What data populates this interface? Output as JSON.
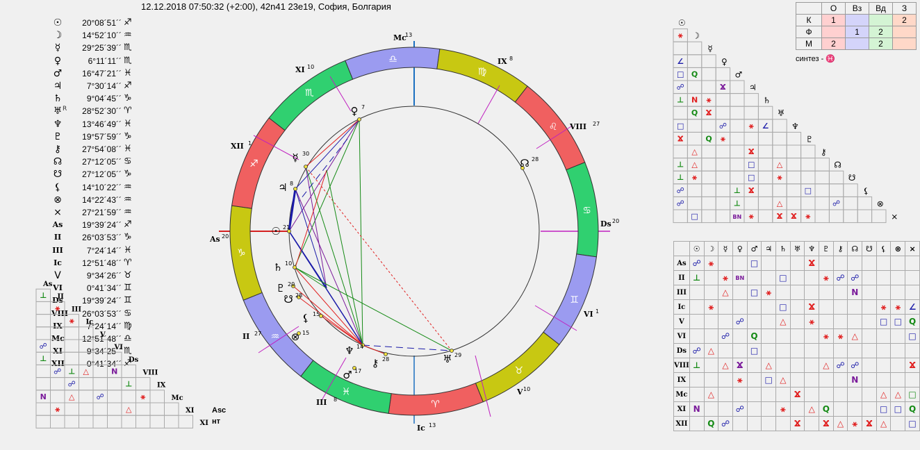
{
  "header": {
    "title": "12.12.2018 07:50:32 (+2:00), 42n41 23e19, София, Болгария"
  },
  "planets": [
    {
      "glyph": "☉",
      "pos": "20°08´51´´",
      "sign": "♐",
      "retro": ""
    },
    {
      "glyph": "☽",
      "pos": "14°52´10´´",
      "sign": "♒",
      "retro": ""
    },
    {
      "glyph": "☿",
      "pos": "29°25´39´´",
      "sign": "♏",
      "retro": ""
    },
    {
      "glyph": "♀",
      "pos": "6°11´11´´",
      "sign": "♏",
      "retro": ""
    },
    {
      "glyph": "♂",
      "pos": "16°47´21´´",
      "sign": "♓",
      "retro": ""
    },
    {
      "glyph": "♃",
      "pos": "7°30´14´´",
      "sign": "♐",
      "retro": ""
    },
    {
      "glyph": "♄",
      "pos": "9°04´45´´",
      "sign": "♑",
      "retro": ""
    },
    {
      "glyph": "♅",
      "pos": "28°52´30´´",
      "sign": "♈",
      "retro": "R"
    },
    {
      "glyph": "♆",
      "pos": "13°46´49´´",
      "sign": "♓",
      "retro": ""
    },
    {
      "glyph": "♇",
      "pos": "19°57´59´´",
      "sign": "♑",
      "retro": ""
    },
    {
      "glyph": "⚷",
      "pos": "27°54´08´´",
      "sign": "♓",
      "retro": ""
    },
    {
      "glyph": "☊",
      "pos": "27°12´05´´",
      "sign": "♋",
      "retro": ""
    },
    {
      "glyph": "☋",
      "pos": "27°12´05´´",
      "sign": "♑",
      "retro": ""
    },
    {
      "glyph": "⚸",
      "pos": "14°10´22´´",
      "sign": "♒",
      "retro": ""
    },
    {
      "glyph": "⊗",
      "pos": "14°22´43´´",
      "sign": "♒",
      "retro": ""
    },
    {
      "glyph": "⨯",
      "pos": "27°21´59´´",
      "sign": "♒",
      "retro": ""
    },
    {
      "glyph": "As",
      "pos": "19°39´24´´",
      "sign": "♐",
      "retro": ""
    },
    {
      "glyph": "II",
      "pos": "26°03´53´´",
      "sign": "♑",
      "retro": ""
    },
    {
      "glyph": "III",
      "pos": "7°24´14´´",
      "sign": "♓",
      "retro": ""
    },
    {
      "glyph": "Ic",
      "pos": "12°51´48´´",
      "sign": "♈",
      "retro": ""
    },
    {
      "glyph": "V",
      "pos": "9°34´26´´",
      "sign": "♉",
      "retro": ""
    },
    {
      "glyph": "VI",
      "pos": "0°41´34´´",
      "sign": "♊",
      "retro": ""
    },
    {
      "glyph": "Ds",
      "pos": "19°39´24´´",
      "sign": "♊",
      "retro": ""
    },
    {
      "glyph": "VIII",
      "pos": "26°03´53´´",
      "sign": "♋",
      "retro": ""
    },
    {
      "glyph": "IX",
      "pos": "7°24´14´´",
      "sign": "♍",
      "retro": ""
    },
    {
      "glyph": "Mc",
      "pos": "12°51´48´´",
      "sign": "♎",
      "retro": ""
    },
    {
      "glyph": "XI",
      "pos": "9°34´25´´",
      "sign": "♏",
      "retro": ""
    },
    {
      "glyph": "XII",
      "pos": "0°41´34´´",
      "sign": "♐",
      "retro": ""
    }
  ],
  "asc_nt": {
    "line1": "Asc",
    "line2": "нт"
  },
  "elements_table": {
    "columns": [
      "О",
      "Вз",
      "Вд",
      "З"
    ],
    "rows": [
      {
        "label": "К",
        "cells": [
          "1",
          "",
          "",
          "2"
        ]
      },
      {
        "label": "Ф",
        "cells": [
          "",
          "1",
          "2",
          ""
        ]
      },
      {
        "label": "М",
        "cells": [
          "2",
          "",
          "2",
          ""
        ]
      }
    ],
    "column_colors": [
      "#ffd0d0",
      "#d4d4fa",
      "#d4f4d4",
      "#ffd8c8"
    ]
  },
  "synthesis": "синтез - ♓",
  "aspect_symbols": {
    "conj": "☌",
    "opp": "☍",
    "tri": "△",
    "sq": "□",
    "sext": "⚹",
    "semisq": "∠",
    "sesq": "⚼",
    "quinc": "⚻",
    "semisext": "⊥",
    "novile": "N",
    "quint": "Q",
    "biquint": "BN"
  },
  "aspect_colors": {
    "red": "#e02020",
    "blue": "#1a1aa8",
    "green": "#158a15",
    "purple": "#7a1a9a"
  },
  "triangle_grid": {
    "headers": [
      "☉",
      "☽",
      "☿",
      "♀",
      "♂",
      "♃",
      "♄",
      "♅",
      "♆",
      "♇",
      "⚷",
      "☊",
      "☋",
      "⚸",
      "⊗",
      "⨯"
    ],
    "cells": [
      [],
      [
        "⚹r"
      ],
      [
        "",
        ""
      ],
      [
        "∠b",
        "",
        "",
        ""
      ],
      [
        "□b",
        "Qg",
        "",
        "",
        ""
      ],
      [
        "☍b",
        "",
        "",
        "Ϫp",
        "",
        ""
      ],
      [
        "⊥g",
        "Nr",
        "⚹r",
        "",
        "",
        "",
        ""
      ],
      [
        "",
        "Qg",
        "Ϫr",
        "",
        "",
        "",
        "",
        ""
      ],
      [
        "□b",
        "",
        "",
        "☍b",
        "",
        "⚹r",
        "∠b",
        ""
      ],
      [
        "Ϫr",
        "",
        "Qg",
        "⚹r",
        "",
        "",
        "",
        "",
        ""
      ],
      [
        "",
        "△r",
        "",
        "",
        "",
        "Ϫr",
        "",
        "",
        "",
        ""
      ],
      [
        "⊥g",
        "△r",
        "",
        "",
        "",
        "□b",
        "",
        "△r",
        "",
        "",
        ""
      ],
      [
        "⊥g",
        "⚹r",
        "",
        "",
        "",
        "□b",
        "",
        "⚹r",
        "",
        "",
        "",
        ""
      ],
      [
        "☍b",
        "",
        "",
        "",
        "⊥g",
        "Ϫr",
        "",
        "",
        "",
        "□b",
        "",
        "",
        ""
      ],
      [
        "☍b",
        "",
        "",
        "",
        "⊥g",
        "",
        "",
        "△r",
        "",
        "",
        "",
        "☍b",
        "",
        ""
      ],
      [
        "",
        "□b",
        "",
        "",
        "BNp",
        "⚹r",
        "",
        "Ϫr",
        "Ϫr",
        "⚹r",
        "",
        "",
        "",
        "",
        ""
      ]
    ]
  },
  "main_grid": {
    "col_headers": [
      "☉",
      "☽",
      "☿",
      "♀",
      "♂",
      "♃",
      "♄",
      "♅",
      "♆",
      "♇",
      "⚷",
      "☊",
      "☋",
      "⚸",
      "⊗",
      "⨯"
    ],
    "rows": [
      {
        "label": "As",
        "cells": [
          "☍b",
          "⚹r",
          "",
          "",
          "□b",
          "",
          "",
          "",
          "Ϫr",
          "",
          "",
          "",
          "",
          "",
          "",
          ""
        ]
      },
      {
        "label": "II",
        "cells": [
          "⊥g",
          "",
          "⚹r",
          "BNp",
          "",
          "",
          "□b",
          "",
          "",
          "⚹r",
          "☍b",
          "☍b",
          "",
          "",
          "",
          ""
        ]
      },
      {
        "label": "III",
        "cells": [
          "",
          "",
          "△r",
          "",
          "□b",
          "⚹r",
          "",
          "",
          "",
          "",
          "",
          "Np",
          "",
          "",
          "",
          ""
        ]
      },
      {
        "label": "Ic",
        "cells": [
          "",
          "⚹r",
          "",
          "",
          "",
          "",
          "□b",
          "",
          "Ϫr",
          "",
          "",
          "",
          "",
          "⚹r",
          "⚹r",
          "∠b"
        ]
      },
      {
        "label": "V",
        "cells": [
          "",
          "",
          "",
          "☍b",
          "",
          "",
          "△r",
          "",
          "⚹r",
          "",
          "",
          "",
          "",
          "□b",
          "□b",
          "Qg"
        ]
      },
      {
        "label": "VI",
        "cells": [
          "",
          "",
          "☍b",
          "",
          "Qg",
          "",
          "",
          "",
          "",
          "⚹r",
          "⚹r",
          "△r",
          "",
          "",
          "",
          "□b"
        ]
      },
      {
        "label": "Ds",
        "cells": [
          "☍b",
          "△r",
          "",
          "",
          "□b",
          "",
          "",
          "",
          "",
          "",
          "",
          "",
          "",
          "",
          "",
          ""
        ]
      },
      {
        "label": "VIII",
        "cells": [
          "⊥g",
          "",
          "△r",
          "Ϫp",
          "",
          "△r",
          "",
          "",
          "",
          "△r",
          "☍b",
          "☍b",
          "",
          "",
          "",
          "Ϫr"
        ]
      },
      {
        "label": "IX",
        "cells": [
          "",
          "",
          "",
          "⚹r",
          "",
          "□b",
          "△r",
          "",
          "",
          "",
          "",
          "Np",
          "",
          "",
          "",
          ""
        ]
      },
      {
        "label": "Mc",
        "cells": [
          "",
          "△r",
          "",
          "",
          "",
          "",
          "",
          "Ϫr",
          "",
          "",
          "",
          "",
          "",
          "△r",
          "△r",
          "□g"
        ]
      },
      {
        "label": "XI",
        "cells": [
          "Np",
          "",
          "",
          "☍b",
          "",
          "",
          "⚹r",
          "",
          "△r",
          "Qg",
          "",
          "",
          "",
          "□b",
          "□b",
          "Qg"
        ]
      },
      {
        "label": "XII",
        "cells": [
          "",
          "Qg",
          "☍b",
          "",
          "",
          "",
          "",
          "Ϫr",
          "",
          "Ϫr",
          "△r",
          "⚹r",
          "Ϫr",
          "△r",
          "",
          "□b"
        ]
      }
    ]
  },
  "small_grid": {
    "labels": [
      "As",
      "II",
      "III",
      "Ic",
      "V",
      "VI",
      "Ds",
      "VIII",
      "IX",
      "Mc",
      "XI",
      "XII"
    ],
    "cells": [
      [],
      [
        "⊥g"
      ],
      [
        "",
        "⚹r"
      ],
      [
        "",
        "",
        "⚹r"
      ],
      [
        "",
        "",
        "",
        ""
      ],
      [
        "☍b",
        "",
        "",
        "",
        ""
      ],
      [
        "⊥g",
        "",
        "",
        "",
        "",
        ""
      ],
      [
        "",
        "☍b",
        "⊥g",
        "△r",
        "",
        "Np",
        ""
      ],
      [
        "",
        "",
        "☍b",
        "",
        "",
        "",
        "⊥g",
        ""
      ],
      [
        "Np",
        "",
        "△r",
        "",
        "☍b",
        "",
        "",
        "⚹r",
        ""
      ],
      [
        "",
        "⚹r",
        "",
        "",
        "",
        "",
        "△r",
        "",
        "",
        ""
      ]
    ]
  }
}
